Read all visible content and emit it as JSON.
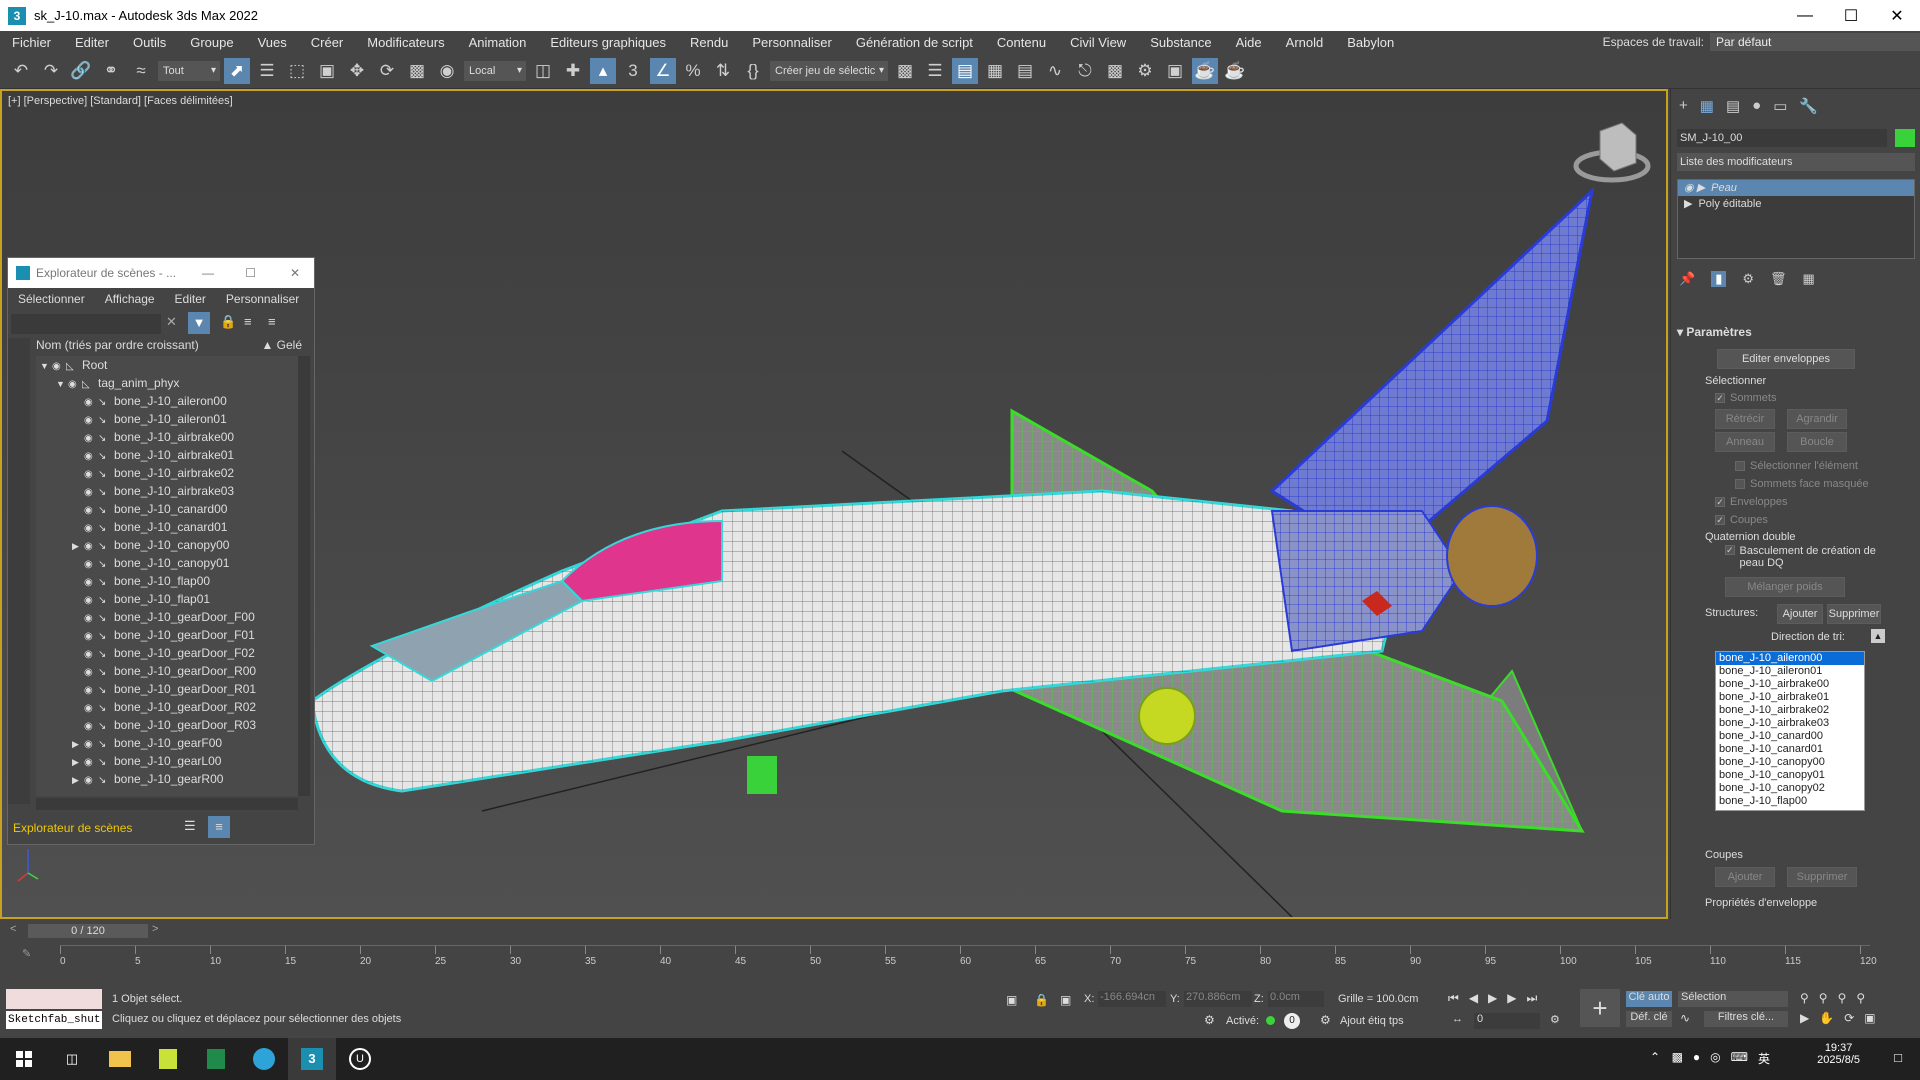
{
  "window": {
    "title": "sk_J-10.max - Autodesk 3ds Max 2022"
  },
  "menu": {
    "items": [
      "Fichier",
      "Editer",
      "Outils",
      "Groupe",
      "Vues",
      "Créer",
      "Modificateurs",
      "Animation",
      "Editeurs graphiques",
      "Rendu",
      "Personnaliser",
      "Génération de script",
      "Contenu",
      "Civil View",
      "Substance",
      "Aide",
      "Arnold",
      "Babylon"
    ],
    "workspace_label": "Espaces de travail:",
    "workspace_value": "Par défaut"
  },
  "toolbar": {
    "filter_value": "Tout",
    "coord_value": "Local",
    "selection_set_placeholder": "Créer jeu de sélectic"
  },
  "viewport": {
    "label": "[+] [Perspective] [Standard] [Faces délimitées]"
  },
  "explorer": {
    "title": "Explorateur de scènes - ...",
    "menu": [
      "Sélectionner",
      "Affichage",
      "Editer",
      "Personnaliser"
    ],
    "column_name": "Nom (triés par ordre croissant)",
    "column_frozen": "▲ Gelé",
    "rows": [
      {
        "label": "Root",
        "depth": 0,
        "expand": "open"
      },
      {
        "label": "tag_anim_phyx",
        "depth": 1,
        "expand": "open"
      },
      {
        "label": "bone_J-10_aileron00",
        "depth": 2,
        "expand": ""
      },
      {
        "label": "bone_J-10_aileron01",
        "depth": 2,
        "expand": ""
      },
      {
        "label": "bone_J-10_airbrake00",
        "depth": 2,
        "expand": ""
      },
      {
        "label": "bone_J-10_airbrake01",
        "depth": 2,
        "expand": ""
      },
      {
        "label": "bone_J-10_airbrake02",
        "depth": 2,
        "expand": ""
      },
      {
        "label": "bone_J-10_airbrake03",
        "depth": 2,
        "expand": ""
      },
      {
        "label": "bone_J-10_canard00",
        "depth": 2,
        "expand": ""
      },
      {
        "label": "bone_J-10_canard01",
        "depth": 2,
        "expand": ""
      },
      {
        "label": "bone_J-10_canopy00",
        "depth": 2,
        "expand": "closed"
      },
      {
        "label": "bone_J-10_canopy01",
        "depth": 2,
        "expand": ""
      },
      {
        "label": "bone_J-10_flap00",
        "depth": 2,
        "expand": ""
      },
      {
        "label": "bone_J-10_flap01",
        "depth": 2,
        "expand": ""
      },
      {
        "label": "bone_J-10_gearDoor_F00",
        "depth": 2,
        "expand": ""
      },
      {
        "label": "bone_J-10_gearDoor_F01",
        "depth": 2,
        "expand": ""
      },
      {
        "label": "bone_J-10_gearDoor_F02",
        "depth": 2,
        "expand": ""
      },
      {
        "label": "bone_J-10_gearDoor_R00",
        "depth": 2,
        "expand": ""
      },
      {
        "label": "bone_J-10_gearDoor_R01",
        "depth": 2,
        "expand": ""
      },
      {
        "label": "bone_J-10_gearDoor_R02",
        "depth": 2,
        "expand": ""
      },
      {
        "label": "bone_J-10_gearDoor_R03",
        "depth": 2,
        "expand": ""
      },
      {
        "label": "bone_J-10_gearF00",
        "depth": 2,
        "expand": "closed"
      },
      {
        "label": "bone_J-10_gearL00",
        "depth": 2,
        "expand": "closed"
      },
      {
        "label": "bone_J-10_gearR00",
        "depth": 2,
        "expand": "closed"
      }
    ],
    "footer_label": "Explorateur de scènes"
  },
  "command_panel": {
    "object_name": "SM_J-10_00",
    "object_color": "#39d23a",
    "modifier_list_label": "Liste des modificateurs",
    "stack": [
      {
        "label": "Peau",
        "selected": true
      },
      {
        "label": "Poly éditable",
        "selected": false
      }
    ],
    "rollout_params": "Paramètres",
    "edit_envelopes": "Editer enveloppes",
    "select_group": "Sélectionner",
    "vertices": "Sommets",
    "shrink": "Rétrécir",
    "grow": "Agrandir",
    "ring": "Anneau",
    "loop": "Boucle",
    "select_element": "Sélectionner l'élément",
    "backface_verts": "Sommets face masquée",
    "envelopes": "Enveloppes",
    "cross_sections": "Coupes",
    "dq_group": "Quaternion double",
    "dq_toggle": "Basculement de création de peau DQ",
    "blend_weights": "Mélanger poids",
    "structures_label": "Structures:",
    "add": "Ajouter",
    "remove": "Supprimer",
    "sort_direction": "Direction de tri:",
    "bones": [
      "bone_J-10_aileron00",
      "bone_J-10_aileron01",
      "bone_J-10_airbrake00",
      "bone_J-10_airbrake01",
      "bone_J-10_airbrake02",
      "bone_J-10_airbrake03",
      "bone_J-10_canard00",
      "bone_J-10_canard01",
      "bone_J-10_canopy00",
      "bone_J-10_canopy01",
      "bone_J-10_canopy02",
      "bone_J-10_flap00"
    ],
    "cross_sections_group": "Coupes",
    "cs_add": "Ajouter",
    "cs_remove": "Supprimer",
    "envelope_props": "Propriétés d'enveloppe"
  },
  "timeline": {
    "frame_display": "0 / 120",
    "ticks": [
      "0",
      "5",
      "10",
      "15",
      "20",
      "25",
      "30",
      "35",
      "40",
      "45",
      "50",
      "55",
      "60",
      "65",
      "70",
      "75",
      "80",
      "85",
      "90",
      "95",
      "100",
      "105",
      "110",
      "115",
      "120"
    ]
  },
  "status": {
    "script_label": "Sketchfab_shut",
    "selected": "1 Objet sélect.",
    "prompt": "Cliquez ou cliquez et déplacez pour sélectionner des objets",
    "x_label": "X:",
    "x_value": "-166.694cn",
    "y_label": "Y:",
    "y_value": "270.886cm",
    "z_label": "Z:",
    "z_value": "0.0cm",
    "grid": "Grille = 100.0cm",
    "active": "Activé:",
    "add_time_tag": "Ajout étiq tps",
    "auto_key": "Clé auto",
    "set_key": "Déf. clé",
    "selection_mode": "Sélection",
    "key_filters": "Filtres clé...",
    "frame_value": "0"
  },
  "taskbar": {
    "time": "19:37",
    "date": "2025/8/5",
    "ime": "英"
  }
}
